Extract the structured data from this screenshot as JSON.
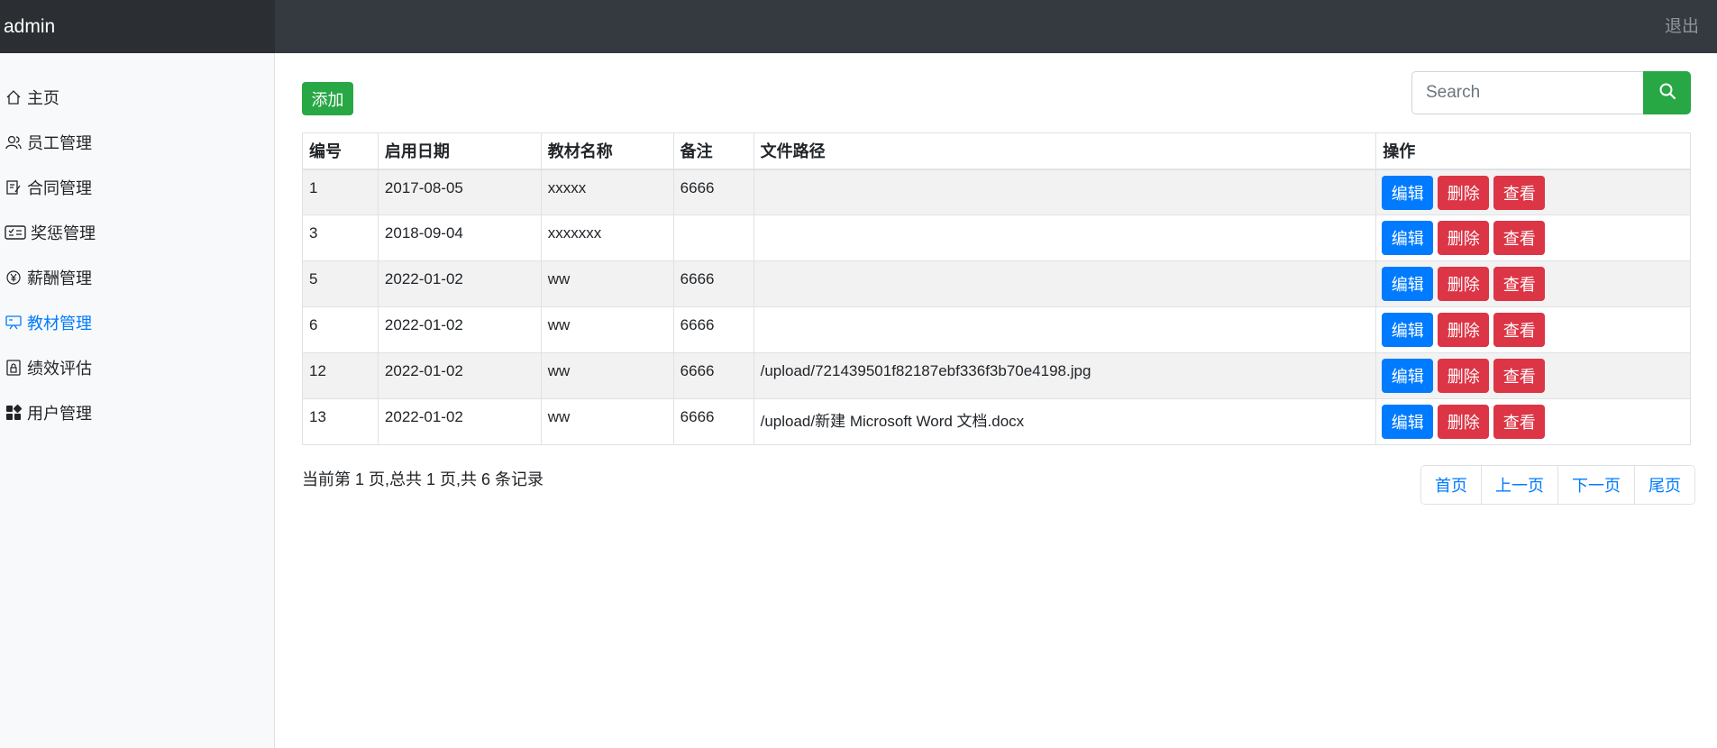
{
  "header": {
    "brand": "admin",
    "logout": "退出"
  },
  "sidebar": {
    "items": [
      {
        "label": "主页",
        "icon": "house-icon",
        "active": false
      },
      {
        "label": "员工管理",
        "icon": "people-icon",
        "active": false
      },
      {
        "label": "合同管理",
        "icon": "journal-edit-icon",
        "active": false
      },
      {
        "label": "奖惩管理",
        "icon": "card-checklist-icon",
        "active": false
      },
      {
        "label": "薪酬管理",
        "icon": "yen-coin-icon",
        "active": false
      },
      {
        "label": "教材管理",
        "icon": "easel-icon",
        "active": true
      },
      {
        "label": "绩效评估",
        "icon": "file-lock-icon",
        "active": false
      },
      {
        "label": "用户管理",
        "icon": "grid-icon",
        "active": false
      }
    ]
  },
  "toolbar": {
    "add_label": "添加",
    "search_placeholder": "Search"
  },
  "table": {
    "headers": [
      "编号",
      "启用日期",
      "教材名称",
      "备注",
      "文件路径",
      "操作"
    ],
    "rows": [
      [
        "1",
        "2017-08-05",
        "xxxxx",
        "6666",
        ""
      ],
      [
        "3",
        "2018-09-04",
        "xxxxxxx",
        "",
        ""
      ],
      [
        "5",
        "2022-01-02",
        "ww",
        "6666",
        ""
      ],
      [
        "6",
        "2022-01-02",
        "ww",
        "6666",
        ""
      ],
      [
        "12",
        "2022-01-02",
        "ww",
        "6666",
        "/upload/721439501f82187ebf336f3b70e4198.jpg"
      ],
      [
        "13",
        "2022-01-02",
        "ww",
        "6666",
        "/upload/新建 Microsoft Word 文档.docx"
      ]
    ],
    "actions": {
      "edit": "编辑",
      "delete": "删除",
      "view": "查看"
    }
  },
  "footer": {
    "records_text": "当前第 1 页,总共 1 页,共 6 条记录",
    "pager": [
      "首页",
      "上一页",
      "下一页",
      "尾页"
    ]
  },
  "colors": {
    "topbar": "#343a40",
    "brand_bg": "#2b2f33",
    "primary": "#007bff",
    "success": "#28a745",
    "danger": "#dc3545"
  }
}
